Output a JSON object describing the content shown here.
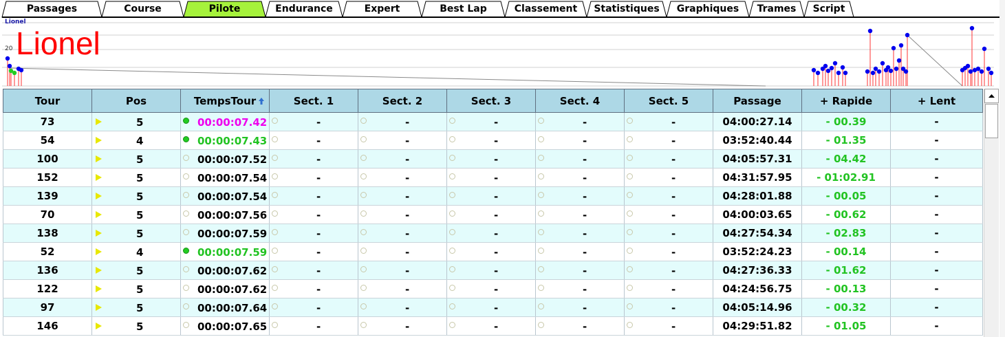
{
  "tabs": [
    {
      "label": "Passages",
      "active": false
    },
    {
      "label": "Course",
      "active": false
    },
    {
      "label": "Pilote",
      "active": true
    },
    {
      "label": "Endurance",
      "active": false
    },
    {
      "label": "Expert",
      "active": false
    },
    {
      "label": "Best Lap",
      "active": false
    },
    {
      "label": "Classement",
      "active": false
    },
    {
      "label": "Statistiques",
      "active": false
    },
    {
      "label": "Graphiques",
      "active": false
    },
    {
      "label": "Trames",
      "active": false
    },
    {
      "label": "Script",
      "active": false
    }
  ],
  "graph": {
    "driver_small": "Lionel",
    "driver_big": "Lionel",
    "tick_label": "20"
  },
  "table": {
    "headers": [
      "Tour",
      "Pos",
      "TempsTour",
      "Sect. 1",
      "Sect. 2",
      "Sect. 3",
      "Sect. 4",
      "Sect. 5",
      "Passage",
      "+ Rapide",
      "+ Lent"
    ],
    "rows": [
      {
        "tour": "73",
        "pos": "5",
        "time": "00:00:07.42",
        "time_color": "purple",
        "dot": "green",
        "s1": "-",
        "s2": "-",
        "s3": "-",
        "s4": "-",
        "s5": "-",
        "passage": "04:00:27.14",
        "rapide": "- 00.39",
        "lent": "-"
      },
      {
        "tour": "54",
        "pos": "4",
        "time": "00:00:07.43",
        "time_color": "green",
        "dot": "green",
        "s1": "-",
        "s2": "-",
        "s3": "-",
        "s4": "-",
        "s5": "-",
        "passage": "03:52:40.44",
        "rapide": "- 01.35",
        "lent": "-"
      },
      {
        "tour": "100",
        "pos": "5",
        "time": "00:00:07.52",
        "time_color": "black",
        "dot": "empty",
        "s1": "-",
        "s2": "-",
        "s3": "-",
        "s4": "-",
        "s5": "-",
        "passage": "04:05:57.31",
        "rapide": "- 04.42",
        "lent": "-"
      },
      {
        "tour": "152",
        "pos": "5",
        "time": "00:00:07.54",
        "time_color": "black",
        "dot": "empty",
        "s1": "-",
        "s2": "-",
        "s3": "-",
        "s4": "-",
        "s5": "-",
        "passage": "04:31:57.95",
        "rapide": "- 01:02.91",
        "lent": "-"
      },
      {
        "tour": "139",
        "pos": "5",
        "time": "00:00:07.54",
        "time_color": "black",
        "dot": "empty",
        "s1": "-",
        "s2": "-",
        "s3": "-",
        "s4": "-",
        "s5": "-",
        "passage": "04:28:01.88",
        "rapide": "- 00.05",
        "lent": "-"
      },
      {
        "tour": "70",
        "pos": "5",
        "time": "00:00:07.56",
        "time_color": "black",
        "dot": "empty",
        "s1": "-",
        "s2": "-",
        "s3": "-",
        "s4": "-",
        "s5": "-",
        "passage": "04:00:03.65",
        "rapide": "- 00.62",
        "lent": "-"
      },
      {
        "tour": "138",
        "pos": "5",
        "time": "00:00:07.59",
        "time_color": "black",
        "dot": "empty",
        "s1": "-",
        "s2": "-",
        "s3": "-",
        "s4": "-",
        "s5": "-",
        "passage": "04:27:54.34",
        "rapide": "- 02.83",
        "lent": "-"
      },
      {
        "tour": "52",
        "pos": "4",
        "time": "00:00:07.59",
        "time_color": "green",
        "dot": "green",
        "s1": "-",
        "s2": "-",
        "s3": "-",
        "s4": "-",
        "s5": "-",
        "passage": "03:52:24.23",
        "rapide": "- 00.14",
        "lent": "-"
      },
      {
        "tour": "136",
        "pos": "5",
        "time": "00:00:07.62",
        "time_color": "black",
        "dot": "empty",
        "s1": "-",
        "s2": "-",
        "s3": "-",
        "s4": "-",
        "s5": "-",
        "passage": "04:27:36.33",
        "rapide": "- 01.62",
        "lent": "-"
      },
      {
        "tour": "122",
        "pos": "5",
        "time": "00:00:07.62",
        "time_color": "black",
        "dot": "empty",
        "s1": "-",
        "s2": "-",
        "s3": "-",
        "s4": "-",
        "s5": "-",
        "passage": "04:24:56.75",
        "rapide": "- 00.13",
        "lent": "-"
      },
      {
        "tour": "97",
        "pos": "5",
        "time": "00:00:07.64",
        "time_color": "black",
        "dot": "empty",
        "s1": "-",
        "s2": "-",
        "s3": "-",
        "s4": "-",
        "s5": "-",
        "passage": "04:05:14.96",
        "rapide": "- 00.32",
        "lent": "-"
      },
      {
        "tour": "146",
        "pos": "5",
        "time": "00:00:07.65",
        "time_color": "black",
        "dot": "empty",
        "s1": "-",
        "s2": "-",
        "s3": "-",
        "s4": "-",
        "s5": "-",
        "passage": "04:29:51.82",
        "rapide": "- 01.05",
        "lent": "-"
      }
    ]
  },
  "colors": {
    "active_tab": "#a6f23c",
    "header_bg": "#add8e6",
    "row_alt": "#e3fcfc",
    "best_time": "#ee00ee",
    "good_time": "#22c322",
    "rapide_text": "#22c322",
    "driver_name": "#ff0000"
  },
  "icons": {
    "sort": "sort-arrow-up-icon",
    "position": "position-arrow-icon",
    "lap_status": "lap-status-dot-icon"
  }
}
